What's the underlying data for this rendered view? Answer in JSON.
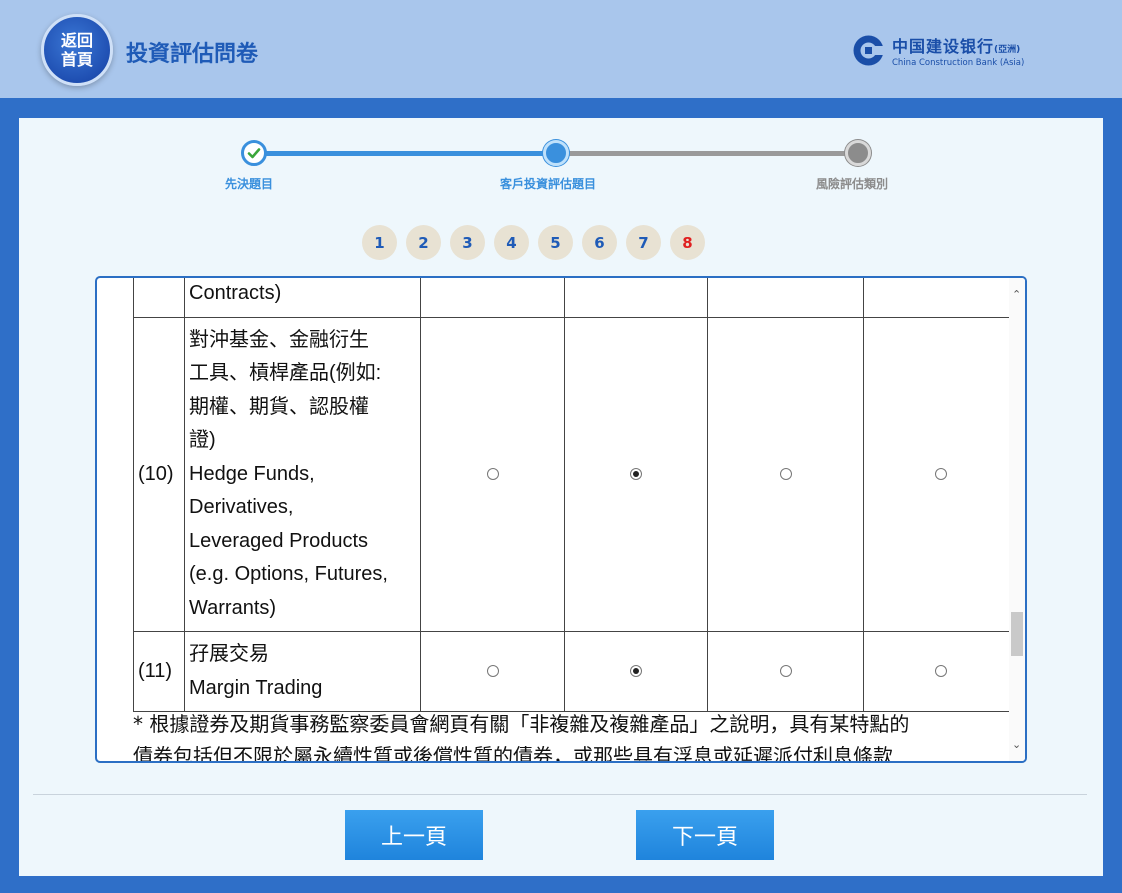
{
  "header": {
    "home_label_line1": "返回",
    "home_label_line2": "首頁",
    "title": "投資評估問卷",
    "brand_zh": "中国建设银行",
    "brand_zh_suffix": "(亞洲)",
    "brand_en": "China Construction Bank (Asia)"
  },
  "stepper": {
    "steps": [
      {
        "label": "先決題目",
        "state": "done"
      },
      {
        "label": "客戶投資評估題目",
        "state": "current"
      },
      {
        "label": "風險評估類別",
        "state": "pending"
      }
    ],
    "colors": {
      "done": "#3a90dd",
      "pending": "#8c8c8c"
    }
  },
  "pager": {
    "items": [
      "1",
      "2",
      "3",
      "4",
      "5",
      "6",
      "7",
      "8"
    ],
    "current": "8",
    "current_color": "#e02020"
  },
  "table": {
    "rows": [
      {
        "number": "",
        "desc_lines": [
          "Contracts)"
        ],
        "selected": -1
      },
      {
        "number": "(10)",
        "desc_lines": [
          "對沖基金、金融衍生",
          "工具、槓桿產品(例如:",
          "期權、期貨、認股權",
          "證)",
          "Hedge Funds,",
          "Derivatives,",
          "Leveraged Products",
          "(e.g. Options, Futures,",
          "Warrants)"
        ],
        "selected": 1
      },
      {
        "number": "(11)",
        "desc_lines": [
          "孖展交易",
          "Margin Trading"
        ],
        "selected": 1
      }
    ]
  },
  "footnote": {
    "line1": "* 根據證券及期貨事務監察委員會網頁有關「非複雜及複雜產品」之說明，具有某特點的",
    "line2": "債券包括但不限於屬永續性質或後償性質的債券，或那些具有浮息或延遲派付利息條款"
  },
  "buttons": {
    "prev": "上一頁",
    "next": "下一頁"
  }
}
